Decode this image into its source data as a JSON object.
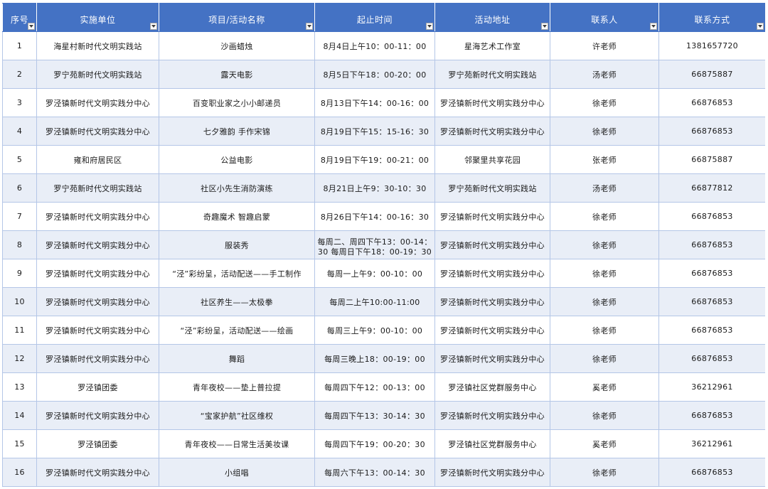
{
  "table": {
    "headers": [
      "序号",
      "实施单位",
      "项目/活动名称",
      "起止时间",
      "活动地址",
      "联系人",
      "联系方式"
    ],
    "rows": [
      {
        "no": "1",
        "unit": "海星村新时代文明实践站",
        "name": "沙画蜡烛",
        "time": "8月4日上午10：00-11：00",
        "address": "星海艺术工作室",
        "contact": "许老师",
        "phone": "1381657720"
      },
      {
        "no": "2",
        "unit": "罗宁苑新时代文明实践站",
        "name": "露天电影",
        "time": "8月5日下午18：00-20：00",
        "address": "罗宁苑新时代文明实践站",
        "contact": "汤老师",
        "phone": "66875887"
      },
      {
        "no": "3",
        "unit": "罗泾镇新时代文明实践分中心",
        "name": "百变职业家之小小邮递员",
        "time": "8月13日下午14：00-16：00",
        "address": "罗泾镇新时代文明实践分中心",
        "contact": "徐老师",
        "phone": "66876853"
      },
      {
        "no": "4",
        "unit": "罗泾镇新时代文明实践分中心",
        "name": "七夕雅韵 手作宋锦",
        "time": "8月19日下午15：15-16：30",
        "address": "罗泾镇新时代文明实践分中心",
        "contact": "徐老师",
        "phone": "66876853"
      },
      {
        "no": "5",
        "unit": "雍和府居民区",
        "name": "公益电影",
        "time": "8月19日下午19：00-21：00",
        "address": "邻聚里共享花园",
        "contact": "张老师",
        "phone": "66875887"
      },
      {
        "no": "6",
        "unit": "罗宁苑新时代文明实践站",
        "name": "社区小先生消防演练",
        "time": "8月21日上午9：30-10：30",
        "address": "罗宁苑新时代文明实践站",
        "contact": "汤老师",
        "phone": "66877812"
      },
      {
        "no": "7",
        "unit": "罗泾镇新时代文明实践分中心",
        "name": "奇趣魔术 智趣启蒙",
        "time": "8月26日下午14：00-16：30",
        "address": "罗泾镇新时代文明实践分中心",
        "contact": "徐老师",
        "phone": "66876853"
      },
      {
        "no": "8",
        "unit": "罗泾镇新时代文明实践分中心",
        "name": "服装秀",
        "time": "每周二、周四下午13：00-14：30 每周日下午18：00-19：30",
        "address": "罗泾镇新时代文明实践分中心",
        "contact": "徐老师",
        "phone": "66876853"
      },
      {
        "no": "9",
        "unit": "罗泾镇新时代文明实践分中心",
        "name": "“泾”彩纷呈，活动配送——手工制作",
        "time": "每周一上午9：00-10：00",
        "address": "罗泾镇新时代文明实践分中心",
        "contact": "徐老师",
        "phone": "66876853"
      },
      {
        "no": "10",
        "unit": "罗泾镇新时代文明实践分中心",
        "name": "社区养生——太极拳",
        "time": "每周二上午10:00-11:00",
        "address": "罗泾镇新时代文明实践分中心",
        "contact": "徐老师",
        "phone": "66876853"
      },
      {
        "no": "11",
        "unit": "罗泾镇新时代文明实践分中心",
        "name": "“泾”彩纷呈，活动配送——绘画",
        "time": "每周三上午9：00-10：00",
        "address": "罗泾镇新时代文明实践分中心",
        "contact": "徐老师",
        "phone": "66876853"
      },
      {
        "no": "12",
        "unit": "罗泾镇新时代文明实践分中心",
        "name": "舞蹈",
        "time": "每周三晚上18：00-19：00",
        "address": "罗泾镇新时代文明实践分中心",
        "contact": "徐老师",
        "phone": "66876853"
      },
      {
        "no": "13",
        "unit": "罗泾镇团委",
        "name": "青年夜校——垫上普拉提",
        "time": "每周四下午12：00-13：00",
        "address": "罗泾镇社区党群服务中心",
        "contact": "奚老师",
        "phone": "36212961"
      },
      {
        "no": "14",
        "unit": "罗泾镇新时代文明实践分中心",
        "name": "“宝家护航”社区维权",
        "time": "每周四下午13：30-14：30",
        "address": "罗泾镇新时代文明实践分中心",
        "contact": "徐老师",
        "phone": "66876853"
      },
      {
        "no": "15",
        "unit": "罗泾镇团委",
        "name": "青年夜校——日常生活美妆课",
        "time": "每周四下午19：00-20：30",
        "address": "罗泾镇社区党群服务中心",
        "contact": "奚老师",
        "phone": "36212961"
      },
      {
        "no": "16",
        "unit": "罗泾镇新时代文明实践分中心",
        "name": "小组唱",
        "time": "每周六下午13：00-14：30",
        "address": "罗泾镇新时代文明实践分中心",
        "contact": "徐老师",
        "phone": "66876853"
      }
    ]
  },
  "colors": {
    "header_bg": "#4472c4",
    "header_text": "#ffffff",
    "band_row": "#e9eef7",
    "grid_line": "#b4c6e7"
  },
  "icons": {
    "filter": "filter-dropdown-icon"
  }
}
